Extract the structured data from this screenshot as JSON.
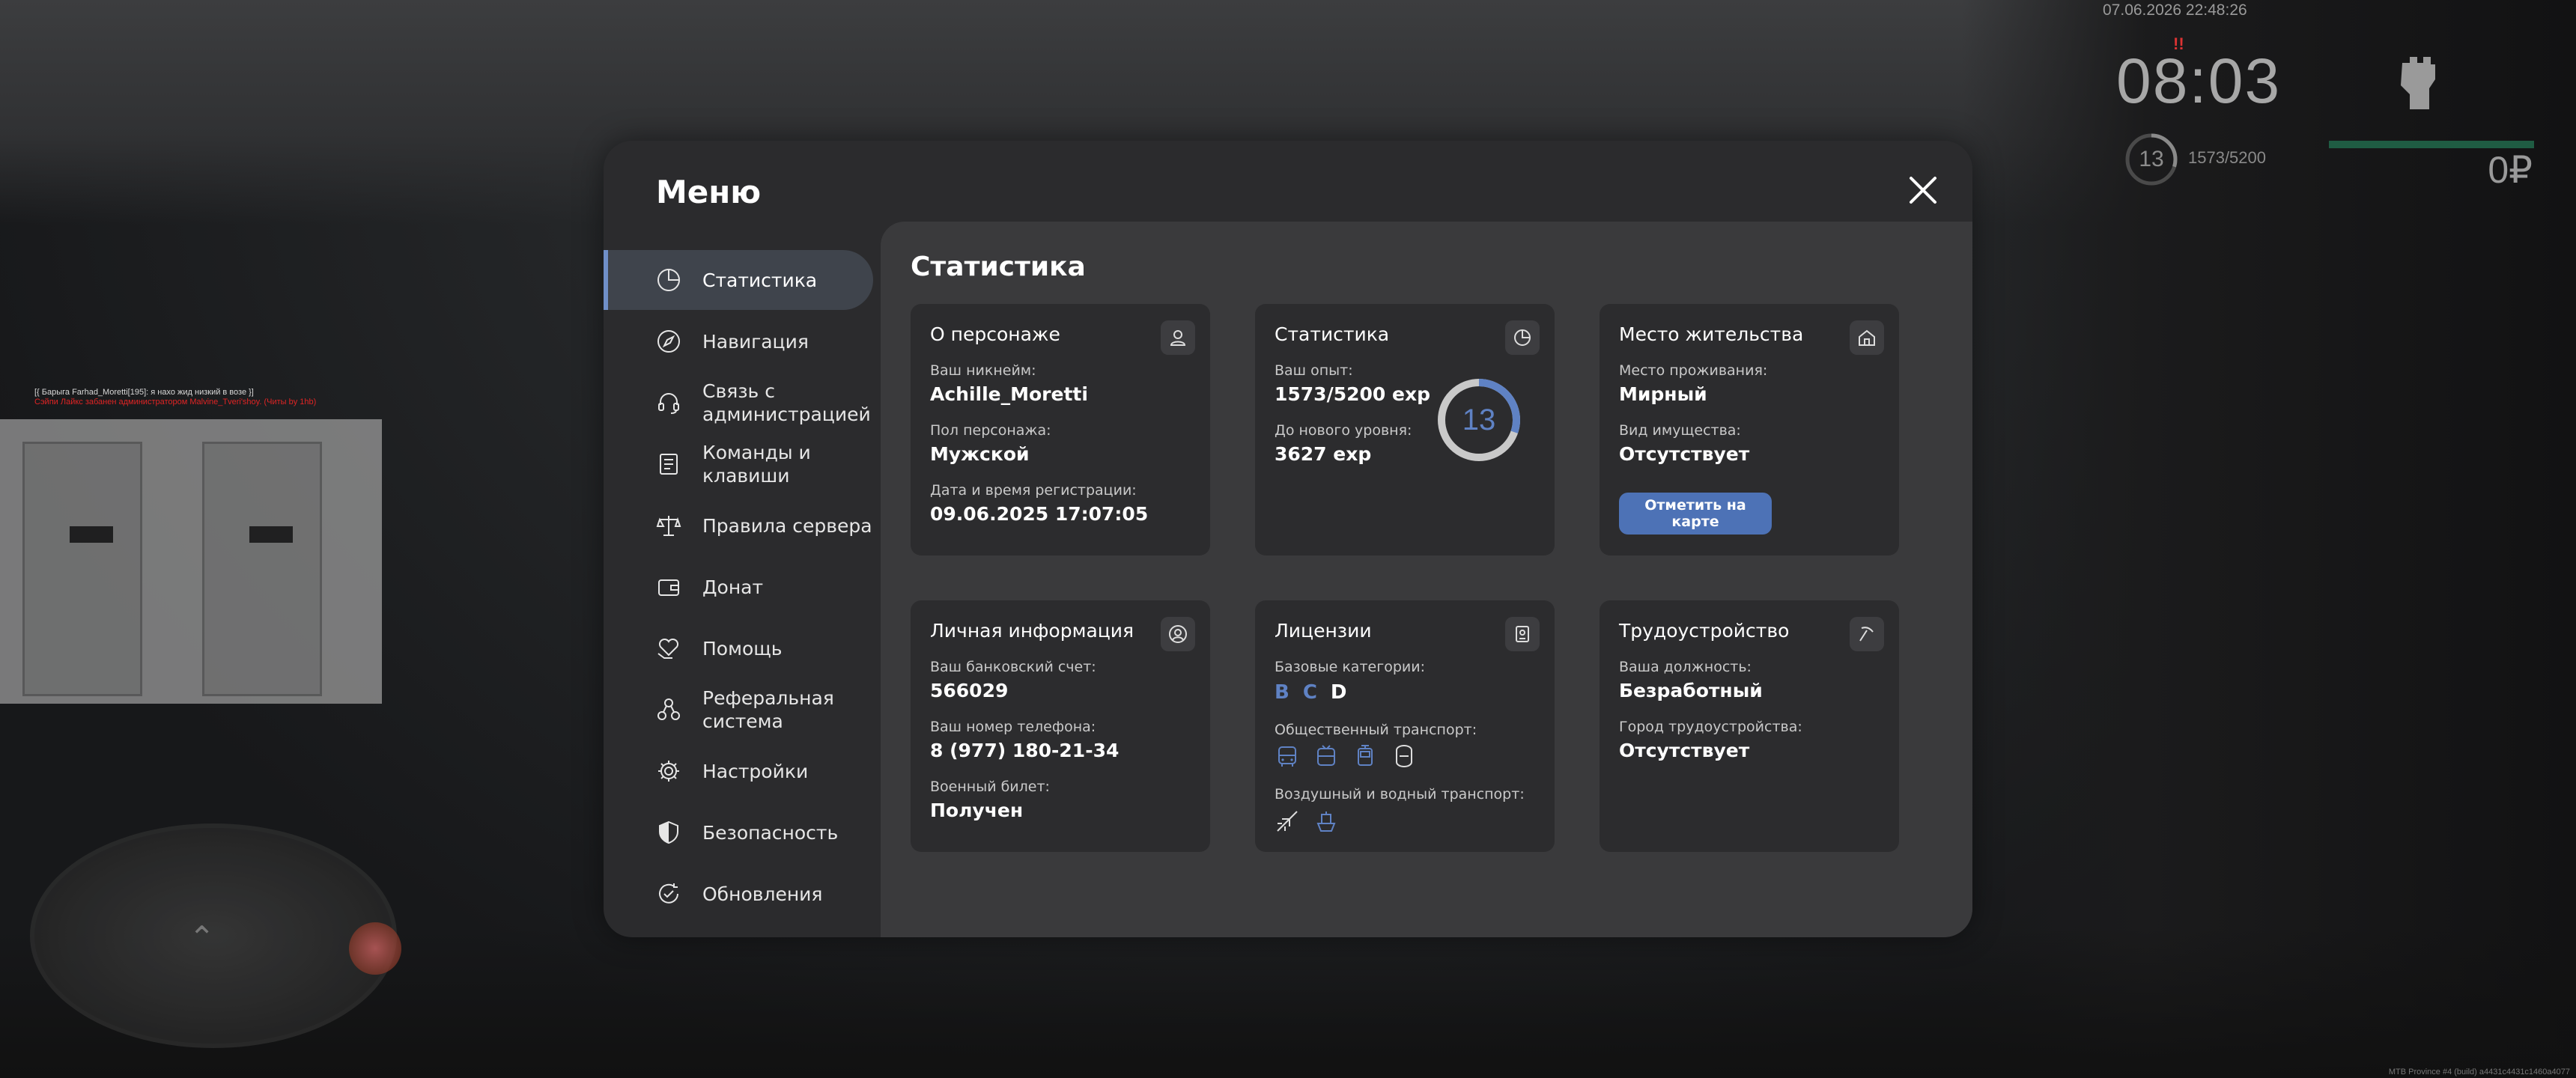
{
  "hud": {
    "datetime": "07.06.2026 22:48:26",
    "alert_mark": "!!",
    "clock": "08:03",
    "level": "13",
    "exp": "1573/5200",
    "money": "0₽"
  },
  "chat": {
    "line1": "[{ Барыга Farhad_Moretti[195]: я нахо жид низкий в возе }]",
    "line2": "Сэйпи Лайкс забанен администратором Malvine_Tveri'shoy. (Читы by 1hb)"
  },
  "build_info": "MTB Province #4 (build) a4431c4431c1460a4077",
  "menu": {
    "title": "Меню",
    "nav": [
      {
        "label": "Статистика",
        "icon": "pie-chart-icon",
        "active": true
      },
      {
        "label": "Навигация",
        "icon": "compass-icon"
      },
      {
        "label": "Связь с администрацией",
        "icon": "headset-icon"
      },
      {
        "label": "Команды и клавиши",
        "icon": "keyboard-list-icon"
      },
      {
        "label": "Правила сервера",
        "icon": "scales-icon"
      },
      {
        "label": "Донат",
        "icon": "wallet-icon"
      },
      {
        "label": "Помощь",
        "icon": "heart-hand-icon"
      },
      {
        "label": "Реферальная система",
        "icon": "referral-icon"
      },
      {
        "label": "Настройки",
        "icon": "gear-icon"
      },
      {
        "label": "Безопасность",
        "icon": "shield-icon"
      },
      {
        "label": "Обновления",
        "icon": "refresh-check-icon"
      }
    ]
  },
  "page": {
    "title": "Статистика",
    "character": {
      "title": "О персонаже",
      "nickname_label": "Ваш никнейм:",
      "nickname": "Achille_Moretti",
      "gender_label": "Пол персонажа:",
      "gender": "Мужской",
      "reg_label": "Дата и время регистрации:",
      "reg": "09.06.2025 17:07:05"
    },
    "stats": {
      "title": "Статистика",
      "exp_label": "Ваш опыт:",
      "exp": "1573/5200 exp",
      "next_label": "До нового уровня:",
      "next": "3627 exp",
      "level": "13",
      "progress": 0.3025
    },
    "residence": {
      "title": "Место жительства",
      "place_label": "Место проживания:",
      "place": "Мирный",
      "property_label": "Вид имущества:",
      "property": "Отсутствует",
      "map_button": "Отметить на карте"
    },
    "personal": {
      "title": "Личная информация",
      "bank_label": "Ваш банковский счет:",
      "bank": "566029",
      "phone_label": "Ваш номер телефона:",
      "phone": "8 (977) 180-21-34",
      "military_label": "Военный билет:",
      "military": "Получен"
    },
    "licenses": {
      "title": "Лицензии",
      "base_label": "Базовые категории:",
      "categories": [
        {
          "letter": "B",
          "color": "#5f82c4"
        },
        {
          "letter": "C",
          "color": "#5f82c4"
        },
        {
          "letter": "D",
          "color": "#ffffff"
        }
      ],
      "public_label": "Общественный транспорт:",
      "air_label": "Воздушный и водный транспорт:"
    },
    "employment": {
      "title": "Трудоустройство",
      "position_label": "Ваша должность:",
      "position": "Безработный",
      "city_label": "Город трудоустройства:",
      "city": "Отсутствует"
    }
  },
  "colors": {
    "accent": "#5f82c4",
    "button": "#4d72b6",
    "card": "#2c2c2e",
    "panel": "#3a3a3c"
  }
}
